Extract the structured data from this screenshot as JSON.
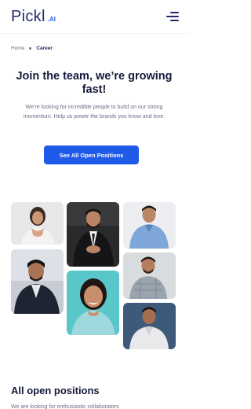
{
  "header": {
    "logo_main": "Pickl",
    "logo_suffix": ".AI",
    "menu_icon": "hamburger-menu-icon"
  },
  "breadcrumb": {
    "home": "Home",
    "current": "Career"
  },
  "hero": {
    "title": "Join the team, we’re growing fast!",
    "subtitle": "We’re looking for incredible people to build on our strong momentum. Help us power the brands you know and love.",
    "cta_label": "See All Open Positions"
  },
  "positions": {
    "title": "All open positions",
    "subtitle": "We are looking for enthusiastic collaborators"
  },
  "colors": {
    "brand": "#23296b",
    "accent": "#1f5ae8",
    "heading": "#151a3c",
    "muted": "#6b6f88"
  }
}
